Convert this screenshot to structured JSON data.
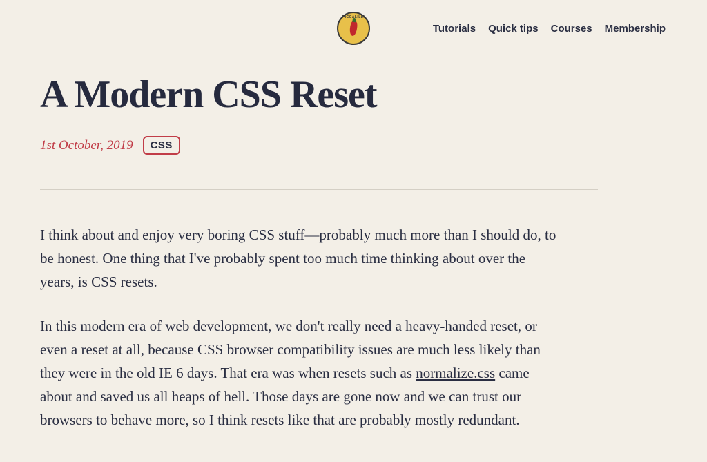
{
  "logo": {
    "brand_text": "PICCALILLI"
  },
  "nav": {
    "items": [
      "Tutorials",
      "Quick tips",
      "Courses",
      "Membership"
    ]
  },
  "article": {
    "title": "A Modern CSS Reset",
    "date": "1st October, 2019",
    "tag": "CSS",
    "p1": "I think about and enjoy very boring CSS stuff—probably much more than I should do, to be honest. One thing that I've probably spent too much time thinking about over the years, is CSS resets.",
    "p2_a": "In this modern era of web development, we don't really need a heavy-handed reset, or even a reset at all, because CSS browser compatibility issues are much less likely than they were in the old IE 6 days. That era was when resets such as ",
    "p2_link": "normalize.css",
    "p2_b": " came about and saved us all heaps of hell. Those days are gone now and we can trust our browsers to behave more, so I think resets like that are probably mostly redundant."
  }
}
